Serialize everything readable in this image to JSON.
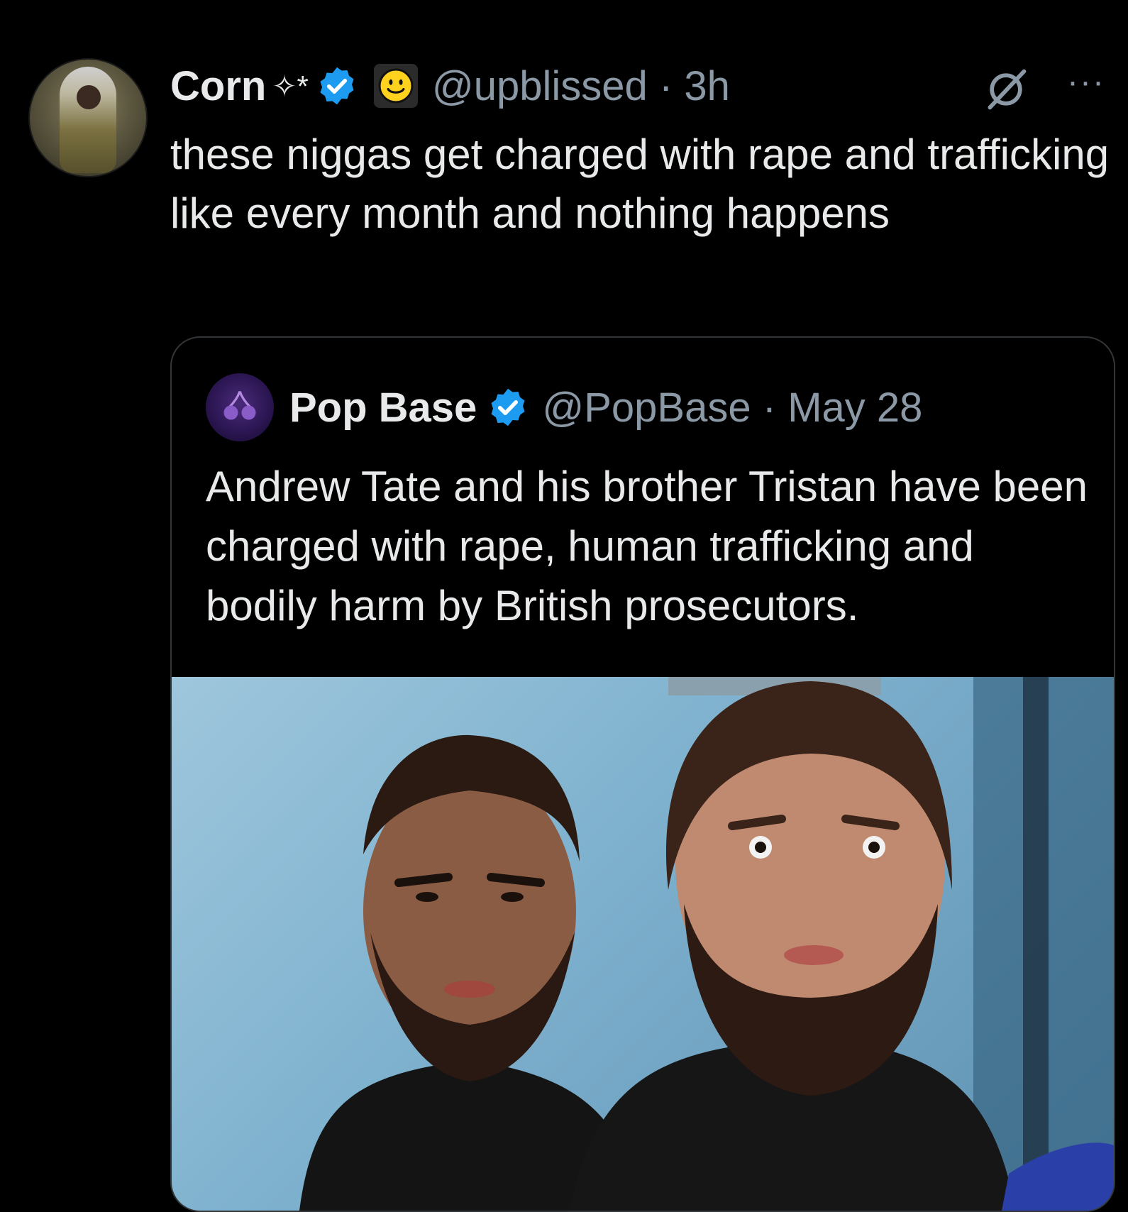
{
  "tweet": {
    "author_name": "Corn",
    "author_decoration": "✧*",
    "handle": "@upblissed",
    "separator": "·",
    "time": "3h",
    "more_label": "···",
    "text": "these niggas get charged with rape and trafficking like every month and nothing happens",
    "icons": [
      "verified-badge-icon",
      "smiley-emoji-icon",
      "grok-icon",
      "more-icon"
    ]
  },
  "quoted_tweet": {
    "author_name": "Pop Base",
    "handle": "@PopBase",
    "separator": "·",
    "date": "May 28",
    "text": "Andrew Tate and his brother Tristan have been charged with rape, human trafficking and bodily harm by British prosecutors.",
    "avatar_icon": "cherry-icon"
  },
  "colors": {
    "background": "#000000",
    "text": "#e7e9ea",
    "secondary_text": "#8b98a5",
    "verified_blue": "#1d9bf0",
    "border": "#333639"
  }
}
